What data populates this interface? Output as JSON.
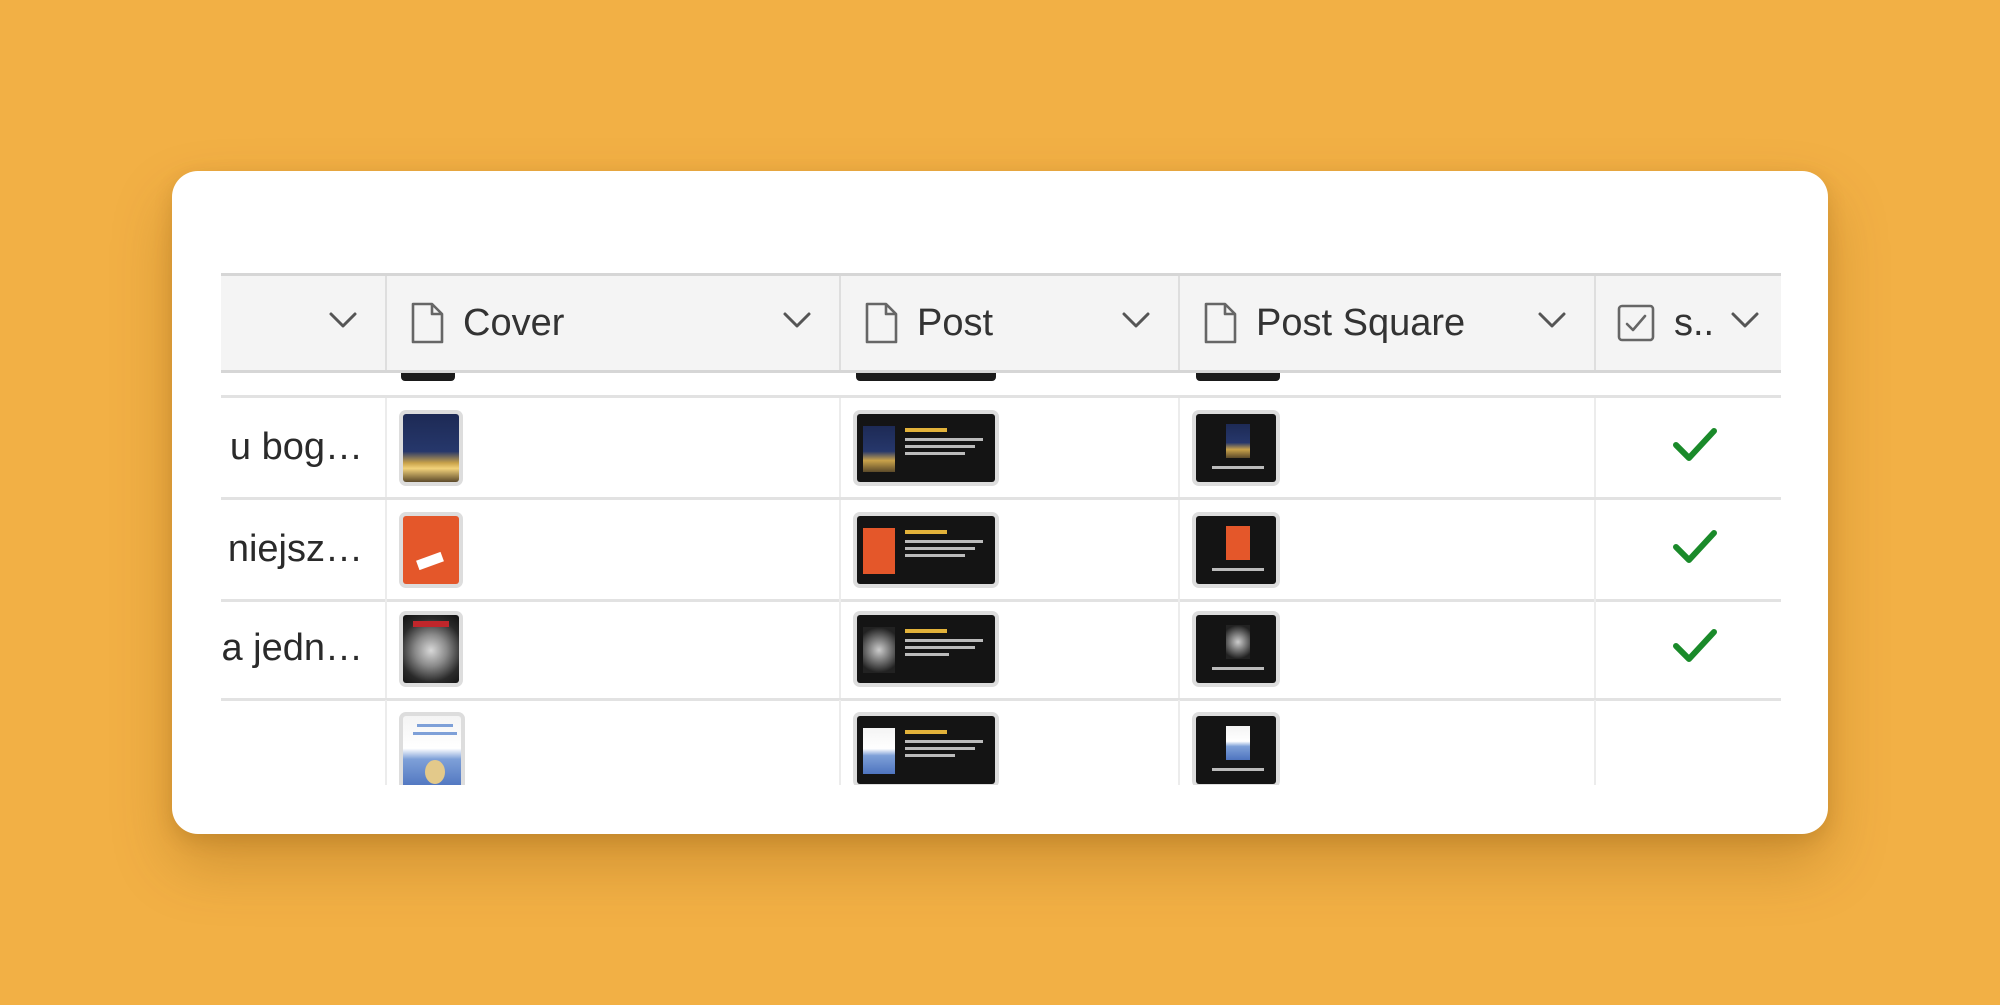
{
  "columns": {
    "cover": {
      "label": "Cover",
      "icon": "file-icon"
    },
    "post": {
      "label": "Post",
      "icon": "file-icon"
    },
    "post_square": {
      "label": "Post Square",
      "icon": "file-icon"
    },
    "checkbox": {
      "label": "s..",
      "icon": "checkbox-icon"
    }
  },
  "rows": [
    {
      "name": "u bog…",
      "checked": true
    },
    {
      "name": "niejsz…",
      "checked": true
    },
    {
      "name": "a jedn…",
      "checked": true
    },
    {
      "name": "",
      "checked": false
    }
  ],
  "colors": {
    "background": "#f2b045",
    "check": "#1a8a2a",
    "header_bg": "#f4f4f4"
  }
}
